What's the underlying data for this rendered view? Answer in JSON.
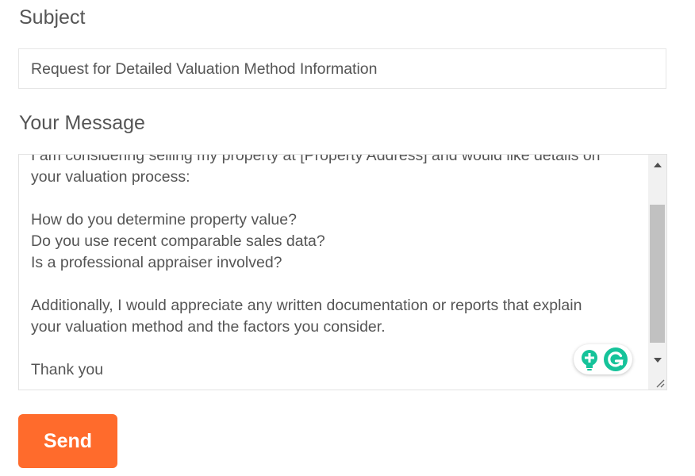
{
  "subject": {
    "label": "Subject",
    "value": "Request for Detailed Valuation Method Information"
  },
  "message": {
    "label": "Your Message",
    "lines": [
      "I am considering selling my property at [Property Address] and would like details on",
      "your valuation process:",
      "",
      "How do you determine property value?",
      "Do you use recent comparable sales data?",
      "Is a professional appraiser involved?",
      "",
      "Additionally, I would appreciate any written documentation or reports that explain",
      "your valuation method and the factors you consider.",
      "",
      "Thank you"
    ]
  },
  "grammarly": {
    "icons": [
      "lightbulb-plus-icon",
      "grammarly-icon"
    ]
  },
  "send": {
    "label": "Send"
  },
  "colors": {
    "accent": "#ff6b2c",
    "text": "#555555",
    "grammarly_green": "#15c39a"
  }
}
